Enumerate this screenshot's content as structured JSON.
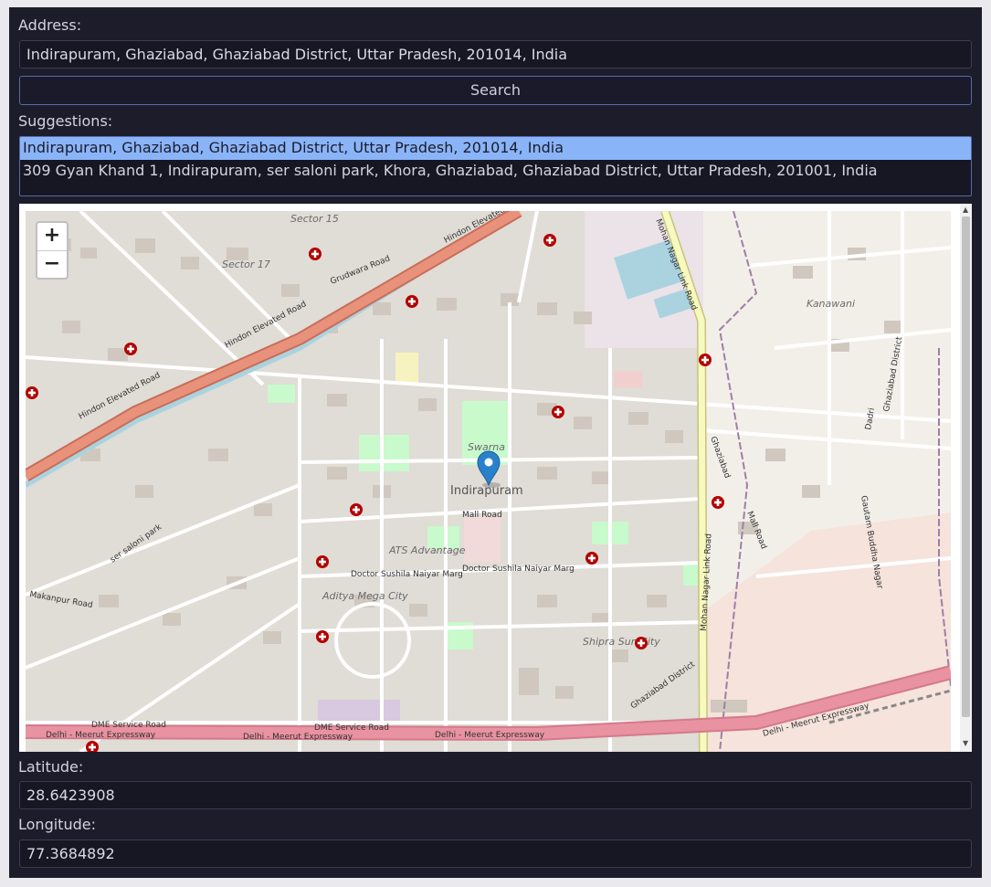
{
  "address": {
    "label": "Address:",
    "value": "Indirapuram, Ghaziabad, Ghaziabad District, Uttar Pradesh, 201014, India"
  },
  "search": {
    "label": "Search"
  },
  "suggestions": {
    "label": "Suggestions:",
    "items": [
      "Indirapuram, Ghaziabad, Ghaziabad District, Uttar Pradesh, 201014, India",
      "309 Gyan Khand 1, Indirapuram, ser saloni park, Khora, Ghaziabad, Ghaziabad District, Uttar Pradesh, 201001, India"
    ],
    "selected_index": 0
  },
  "map": {
    "zoom_in": "+",
    "zoom_out": "−",
    "marker_icon": "map-pin-icon",
    "hospital_icon": "hospital-cross-icon",
    "labels": {
      "sector15": "Sector 15",
      "sector17": "Sector 17",
      "hindon1": "Hindon Elevated",
      "hindon2": "Hindon Elevated Road",
      "hindon3": "Hindon Elevated Road",
      "grudwara": "Grudwara Road",
      "kanawani": "Kanawani",
      "ghaziabad_district": "Ghaziabad District",
      "ghaziabad_district2": "Ghaziabad District",
      "mohan1": "Mohan Nagar Link Road",
      "mohan2": "Mohan Nagar Link Road",
      "swarna": "Swarna",
      "indirapuram": "Indirapuram",
      "mall_road": "Mall Road",
      "mall_road2": "Mall Road",
      "ghaziabad": "Ghaziabad",
      "ats": "ATS Advantage",
      "sushila1": "Doctor Sushila Naiyar Marg",
      "sushila2": "Doctor Sushila Naiyar Marg",
      "ser_saloni": "ser saloni park",
      "makanpur": "Makanpur Road",
      "aditya": "Aditya Mega City",
      "shipra": "Shipra Sun City",
      "dadri": "Dadri",
      "gautam": "Gautam Buddha Nagar",
      "dme": "DME Service Road",
      "dme2": "DME Service Road",
      "expressway1": "Delhi - Meerut Expressway",
      "expressway2": "Delhi - Meerut Expressway",
      "expressway3": "Delhi - Meerut Expressway",
      "expressway4": "Delhi - Meerut Expressway"
    }
  },
  "latitude": {
    "label": "Latitude:",
    "value": "28.6423908"
  },
  "longitude": {
    "label": "Longitude:",
    "value": "77.3684892"
  }
}
